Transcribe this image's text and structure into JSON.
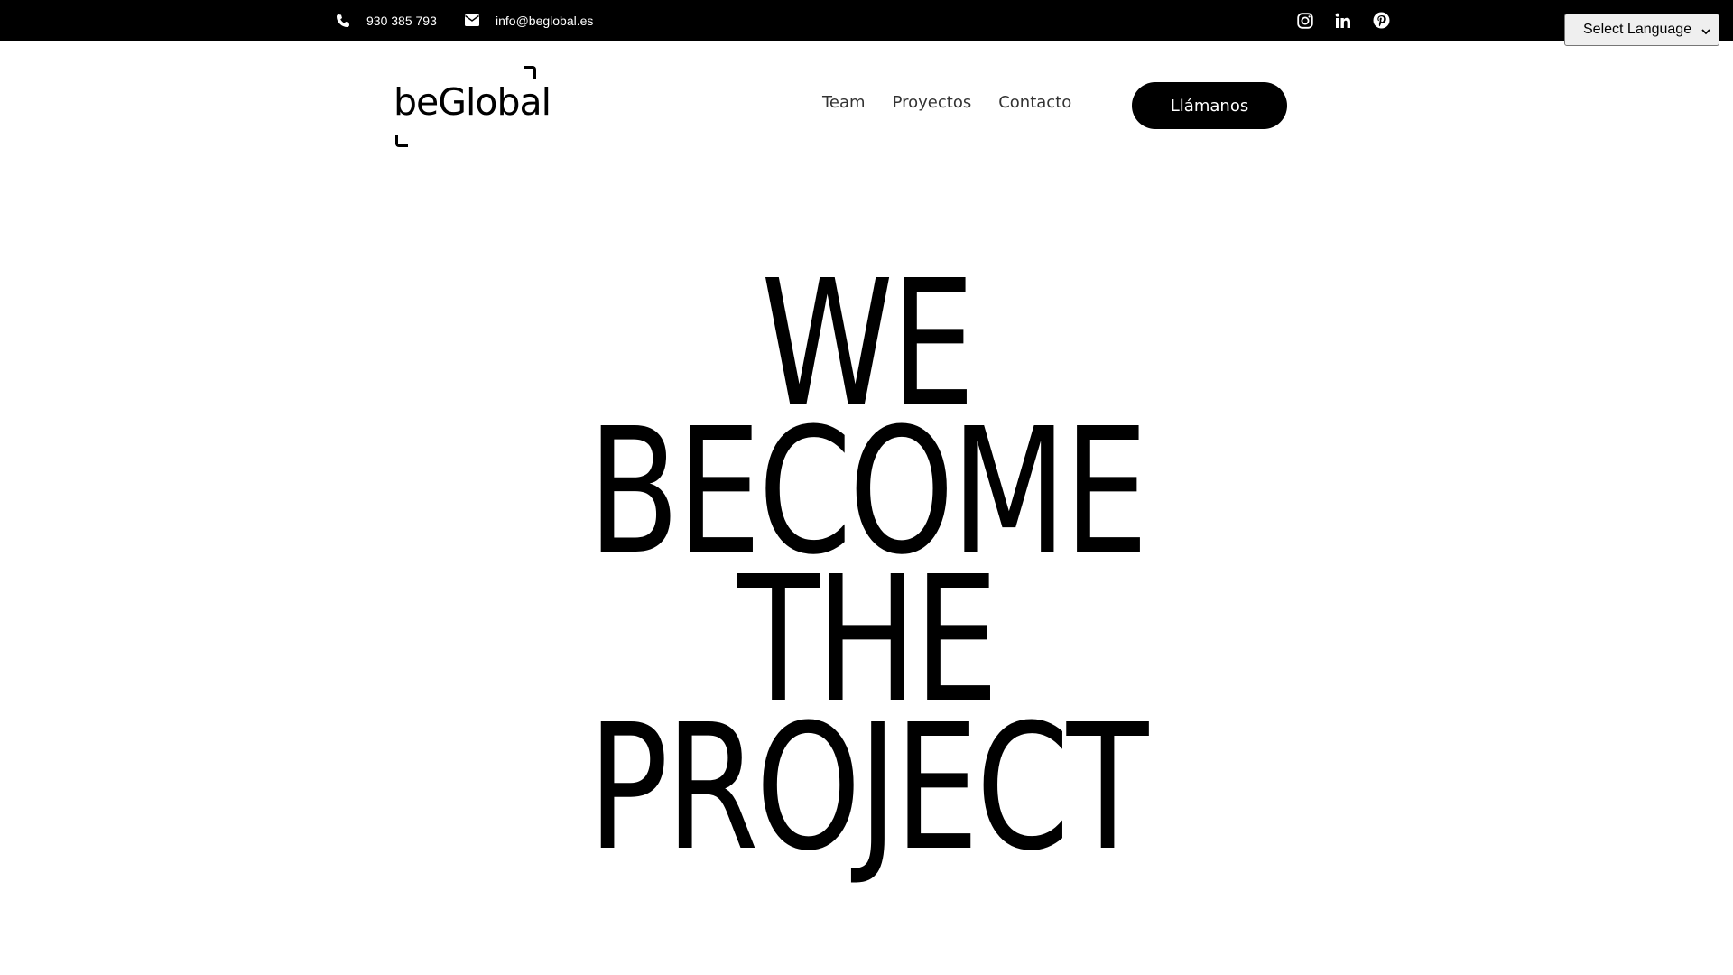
{
  "topbar": {
    "phone": "930 385 793",
    "email": "info@beglobal.es",
    "socials": [
      "instagram-icon",
      "linkedin-icon",
      "pinterest-icon"
    ]
  },
  "language_select": {
    "selected": "Select Language"
  },
  "header": {
    "logo_text": "beGlobal",
    "nav": [
      "Team",
      "Proyectos",
      "Contacto"
    ],
    "cta_label": "Llámanos"
  },
  "hero": {
    "lines": [
      "WE",
      "BECOME",
      "THE",
      "PROJECT"
    ]
  },
  "colors": {
    "topbar_bg": "#000000",
    "text": "#000000",
    "background": "#ffffff",
    "cta_bg": "#000000",
    "cta_text": "#ffffff"
  }
}
